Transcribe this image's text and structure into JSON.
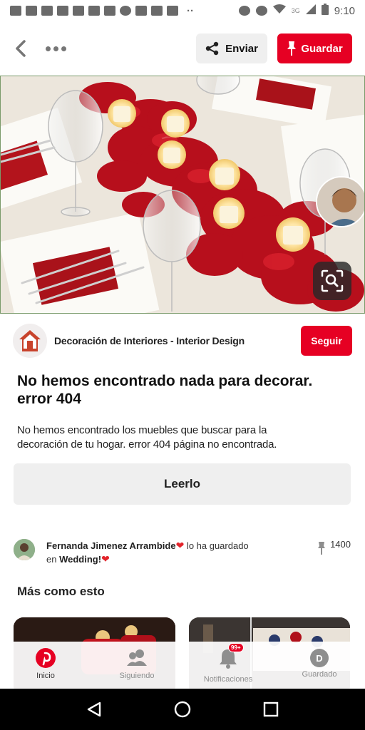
{
  "status_bar": {
    "time": "9:10",
    "network": "3G"
  },
  "topbar": {
    "send_label": "Enviar",
    "save_label": "Guardar"
  },
  "creator": {
    "name": "Decoración de Interiores - Interior Design",
    "follow_label": "Seguir"
  },
  "pin": {
    "title": "No hemos encontrado nada para decorar. error 404",
    "description": "No hemos encontrado los muebles que buscar para la decoración de tu hogar. error 404 página no encontrada.",
    "read_label": "Leerlo"
  },
  "saved_by": {
    "user": "Fernanda Jimenez Arrambide",
    "heart": "❤",
    "action": " lo ha guardado",
    "in_word": "en ",
    "board": "Wedding!",
    "board_heart": "❤",
    "count": "1400"
  },
  "more_like_this": "Más como esto",
  "bottom_nav": {
    "home": "Inicio",
    "following": "Siguiendo",
    "notifications": "Notificaciones",
    "notifications_badge": "99+",
    "saved": "Guardado",
    "saved_initial": "D"
  },
  "colors": {
    "brand_red": "#e60023",
    "button_gray": "#efefef"
  },
  "icons": {
    "back": "chevron-left-icon",
    "more": "more-dots-icon",
    "share": "share-icon",
    "pin": "pushpin-icon",
    "lens": "visual-search-icon",
    "home": "pinterest-logo-icon",
    "following": "people-icon",
    "notifications": "bell-icon",
    "android_back": "triangle-back-icon",
    "android_home": "circle-home-icon",
    "android_recents": "square-recents-icon"
  }
}
